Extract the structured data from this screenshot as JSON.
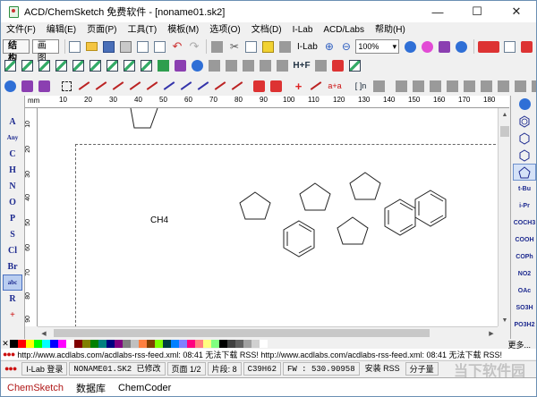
{
  "window": {
    "title": "ACD/ChemSketch 免费软件 - [noname01.sk2]",
    "minimize": "—",
    "maximize": "☐",
    "close": "✕"
  },
  "menu": [
    "文件(F)",
    "编辑(E)",
    "页面(P)",
    "工具(T)",
    "模板(M)",
    "选项(O)",
    "文档(D)",
    "I-Lab",
    "ACD/Labs",
    "帮助(H)"
  ],
  "toolbar1": {
    "mode_structure": "结构",
    "mode_draw": "画图",
    "zoom_value": "100%"
  },
  "toolbar2": {
    "hf_label": "H+F"
  },
  "toolbar3": {
    "atom_label": "a+a",
    "bracket_label": "[ ]n"
  },
  "ruler": {
    "unit": "mm",
    "marks": [
      "10",
      "20",
      "30",
      "40",
      "50",
      "60",
      "70",
      "80",
      "90",
      "100",
      "110",
      "120",
      "130",
      "140",
      "150",
      "160",
      "170",
      "180"
    ],
    "vmarks": [
      "10",
      "20",
      "30",
      "40",
      "50",
      "60",
      "70",
      "80",
      "90"
    ]
  },
  "left_palette": [
    "A",
    "Any",
    "C",
    "H",
    "N",
    "O",
    "P",
    "S",
    "Cl",
    "Br",
    "abc",
    "R",
    "+"
  ],
  "right_palette": [
    "t-Bu",
    "i-Pr",
    "COCH3",
    "COOH",
    "COPh",
    "NO2",
    "OAc",
    "SO3H",
    "PO3H2"
  ],
  "canvas": {
    "label": "CH4"
  },
  "colors": [
    "#000000",
    "#ff0000",
    "#ffff00",
    "#00ff00",
    "#00ffff",
    "#0000ff",
    "#ff00ff",
    "#ffffff",
    "#800000",
    "#808000",
    "#008000",
    "#008080",
    "#000080",
    "#800080",
    "#808080",
    "#c0c0c0",
    "#ff8040",
    "#804000",
    "#80ff00",
    "#004040",
    "#0080ff",
    "#8080ff",
    "#ff0080",
    "#ff8080",
    "#ffff80",
    "#80ff80",
    "#000000",
    "#404040",
    "#606060",
    "#a0a0a0",
    "#d0d0d0",
    "#ffffff"
  ],
  "more_label": "更多...",
  "rss_line": "http://www.acdlabs.com/acdlabs-rss-feed.xml: 08:41 无法下载 RSS! http://www.acdlabs.com/acdlabs-rss-feed.xml: 08:41 无法下载 RSS!",
  "status": {
    "ilab": "I-Lab 登录",
    "file": "NONAME01.SK2 已修改",
    "page": "页面 1/2",
    "fragments": "片段: 8",
    "formula": "C39H62",
    "fw": "FW : 530.90958",
    "install_rss": "安装 RSS",
    "molecular_weight": "分子量"
  },
  "bottom_tabs": [
    "ChemSketch",
    "数据库",
    "ChemCoder"
  ],
  "watermark": "当下软件园"
}
